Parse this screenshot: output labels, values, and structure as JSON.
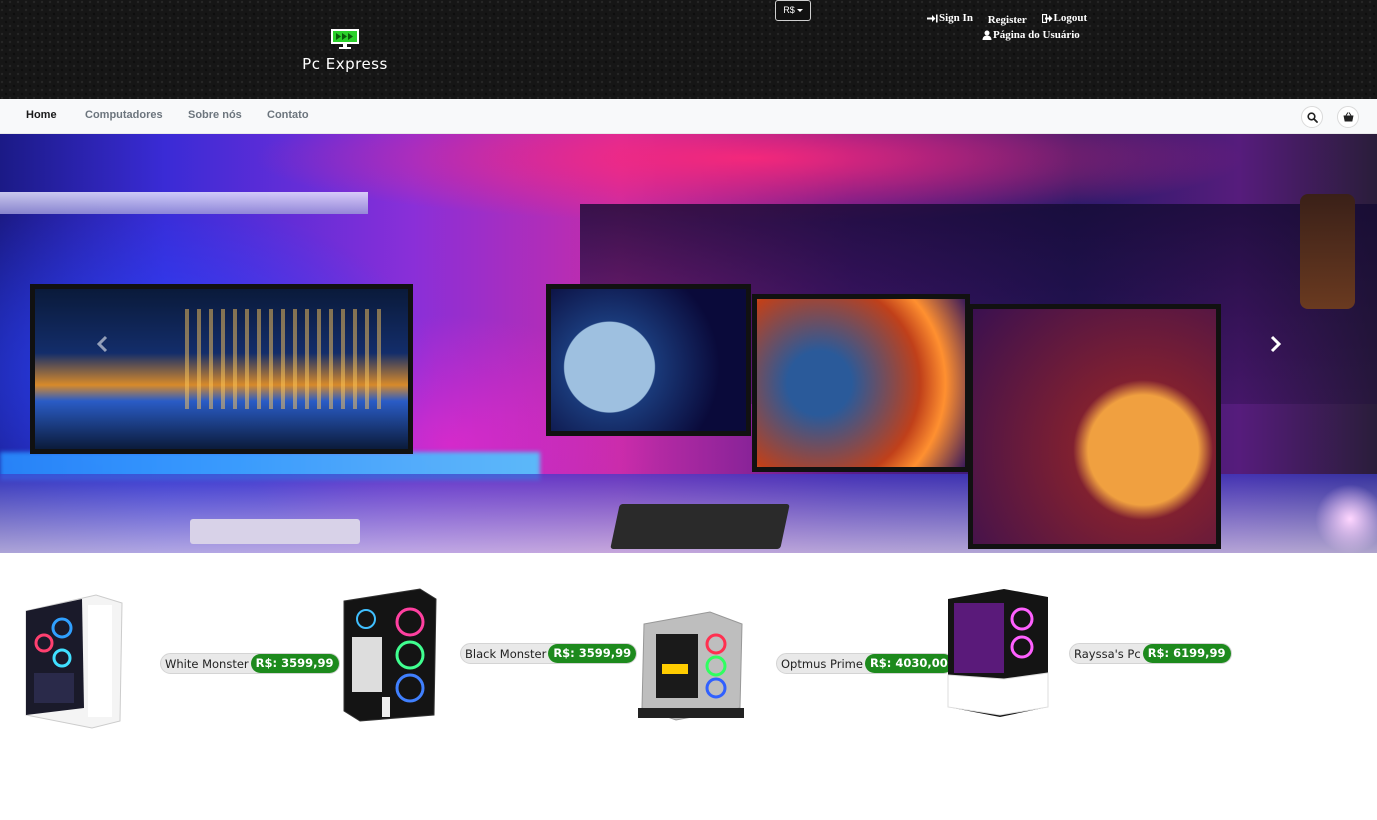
{
  "header": {
    "logo_text": "Pc Express",
    "currency": "R$",
    "links": {
      "sign_in": "Sign In",
      "register": "Register",
      "logout": "Logout",
      "user_page": "Página do Usuário"
    }
  },
  "nav": {
    "items": [
      "Home",
      "Computadores",
      "Sobre nós",
      "Contato"
    ],
    "active": "Home",
    "icons": [
      "search-icon",
      "basket-icon"
    ]
  },
  "hero": {
    "prev_icon": "chevron-left-icon",
    "next_icon": "chevron-right-icon"
  },
  "products": [
    {
      "name": "White Monster",
      "price": "R$: 3599,99"
    },
    {
      "name": "Black Monster",
      "price": "R$: 3599,99"
    },
    {
      "name": "Optmus Prime",
      "price": "R$: 4030,00"
    },
    {
      "name": "Rayssa's Pc",
      "price": "R$: 6199,99"
    }
  ],
  "colors": {
    "header_bg": "#161616",
    "nav_bg": "#f8f9fa",
    "price_bg": "#1d8a1d",
    "logo_green": "#3bd63b"
  }
}
